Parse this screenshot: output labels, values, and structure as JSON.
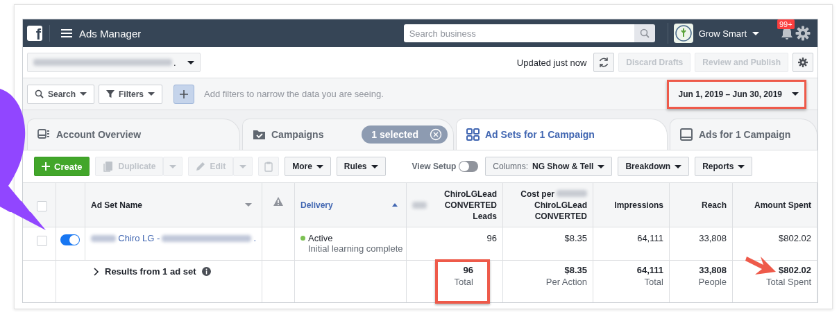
{
  "topbar": {
    "logo": "f",
    "title": "Ads Manager",
    "search": {
      "placeholder": "Search business"
    },
    "account": "Grow Smart",
    "notification_badge": "99+"
  },
  "account_bar": {
    "account_selector": {
      "visible_text": "."
    },
    "status": "Updated just now",
    "buttons": [
      {
        "label": "Discard Drafts",
        "disabled": true
      },
      {
        "label": "Review and Publish",
        "disabled": true
      }
    ]
  },
  "filter_bar": {
    "buttons": [
      {
        "label": "Search",
        "kind": "search"
      },
      {
        "label": "Filters",
        "kind": "filter"
      }
    ],
    "placeholder": "Add filters to narrow the data you are seeing.",
    "date_range": {
      "label": "Jun 1, 2019 – Jun 30, 2019",
      "highlighted": true
    }
  },
  "tabs": [
    {
      "label": "Account Overview",
      "kind": "overview",
      "selected": false
    },
    {
      "label": "Campaigns",
      "kind": "campaigns",
      "selected": false,
      "chip": "1 selected"
    },
    {
      "label": "Ad Sets for 1 Campaign",
      "kind": "adsets",
      "selected": true
    },
    {
      "label": "Ads for 1 Campaign",
      "kind": "ads",
      "selected": false
    }
  ],
  "toolbar": [
    {
      "kind": "primary",
      "label": "Create",
      "disabled": false
    },
    {
      "kind": "duplicate",
      "label": "Duplicate",
      "disabled": true
    },
    {
      "kind": "edit",
      "label": "Edit",
      "disabled": true
    },
    {
      "kind": "clipboard",
      "disabled": true
    },
    {
      "kind": "menu",
      "label": "More",
      "disabled": false
    },
    {
      "kind": "menu",
      "label": "Rules",
      "disabled": false
    },
    {
      "kind": "toggle",
      "label": "View Setup",
      "on": false
    },
    {
      "kind": "menu",
      "prefix": "Columns:",
      "label": "NG Show & Tell",
      "disabled": false
    },
    {
      "kind": "menu",
      "label": "Breakdown",
      "disabled": false
    },
    {
      "kind": "menu",
      "label": "Reports",
      "disabled": false
    }
  ],
  "table": {
    "columns": [
      {
        "kind": "checkbox",
        "checked": false
      },
      {
        "kind": "blank"
      },
      {
        "kind": "name",
        "label": "Ad Set Name",
        "sorted": false
      },
      {
        "kind": "warning"
      },
      {
        "kind": "delivery",
        "label": "Delivery",
        "sorted": true
      },
      {
        "kind": "metric",
        "label": "ChiroLGLead CONVERTED Leads",
        "redacted_prefix": true,
        "sorted": false
      },
      {
        "kind": "metric",
        "label": "Cost per",
        "label_rest": "ChiroLGLead CONVERTED",
        "redacted_middle": true,
        "sorted": false
      },
      {
        "kind": "metric",
        "label": "Impressions",
        "sorted": false
      },
      {
        "kind": "metric",
        "label": "Reach",
        "sorted": false
      },
      {
        "kind": "metric",
        "label": "Amount Spent",
        "sorted": false
      }
    ],
    "rows": [
      {
        "checked": false,
        "on": true,
        "name": "Chiro LG -",
        "name_end": ".",
        "delivery": {
          "status": "Active",
          "detail": "Initial learning complete",
          "color": "#7cc153"
        },
        "values": [
          "96",
          "$8.35",
          "64,111",
          "33,808",
          "$802.02"
        ]
      }
    ],
    "summary": {
      "label": "Results from 1 ad set",
      "cells": [
        {
          "value": "96",
          "caption": "Total",
          "highlighted": true,
          "arrow": false
        },
        {
          "value": "$8.35",
          "caption": "Per Action",
          "highlighted": false,
          "arrow": false
        },
        {
          "value": "64,111",
          "caption": "Total",
          "highlighted": false,
          "arrow": false
        },
        {
          "value": "33,808",
          "caption": "People",
          "highlighted": false,
          "arrow": false
        },
        {
          "value": "$802.02",
          "caption": "Total Spent",
          "highlighted": false,
          "arrow": true
        }
      ]
    }
  }
}
